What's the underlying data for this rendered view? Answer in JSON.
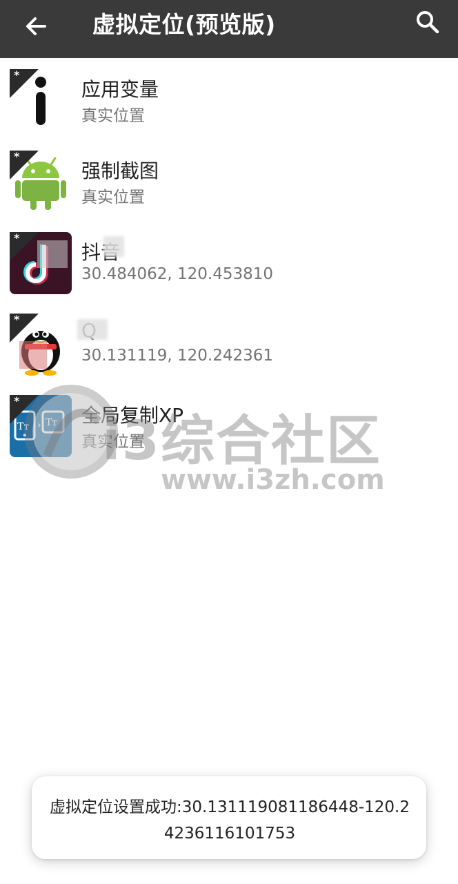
{
  "appbar": {
    "title": "虚拟定位(预览版)",
    "back_icon": "arrow-back-icon",
    "search_icon": "search-icon",
    "background": "#3a3a3a"
  },
  "apps": [
    {
      "name": "应用变量",
      "location": "真实位置",
      "icon": "info-i-icon"
    },
    {
      "name": "强制截图",
      "location": "真实位置",
      "icon": "android-robot-icon"
    },
    {
      "name": "抖音",
      "location": "30.484062, 120.453810",
      "icon": "douyin-app-icon"
    },
    {
      "name": "Q",
      "location": "30.131119, 120.242361",
      "icon": "qq-penguin-icon"
    },
    {
      "name": "全局复制XP",
      "location": "真实位置",
      "icon": "copy-tt-icon"
    }
  ],
  "watermark": {
    "brand": "i3综合社区",
    "url": "www.i3zh.com"
  },
  "toast": {
    "message": "虚拟定位设置成功:30.131119081186448-120.24236116101753"
  }
}
